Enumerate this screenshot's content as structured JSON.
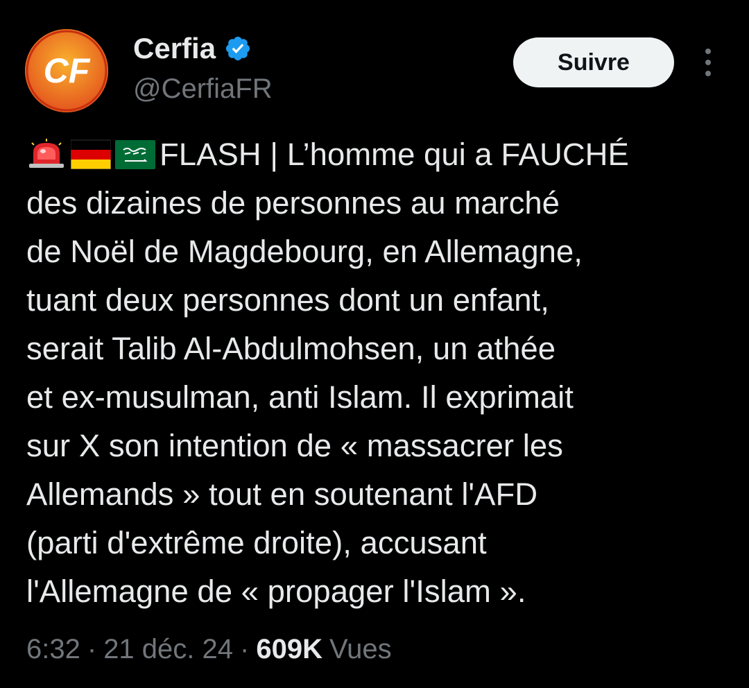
{
  "author": {
    "display_name": "Cerfia",
    "handle": "@CerfiaFR",
    "verified": true,
    "avatar_icon": "cerfia-logo",
    "avatar_color": "#f28a1e"
  },
  "actions": {
    "follow_label": "Suivre",
    "more_icon": "more-vertical-icon"
  },
  "tweet": {
    "emojis": [
      "rotating-light-emoji",
      "germany-flag-emoji",
      "saudi-arabia-flag-emoji"
    ],
    "lines": [
      "FLASH | L’homme qui a FAUCHÉ",
      "des dizaines de personnes au marché",
      "de Noël de Magdebourg, en Allemagne,",
      "tuant deux personnes dont un enfant,",
      "serait Talib Al-Abdulmohsen, un athée",
      "et ex-musulman, anti Islam. Il exprimait",
      "sur X son intention de « massacrer les",
      "Allemands » tout en soutenant l'AFD",
      "(parti d'extrême droite), accusant",
      "l'Allemagne de « propager l'Islam »."
    ]
  },
  "meta": {
    "time": "6:32",
    "separator": "·",
    "date": "21 déc. 24",
    "views_count": "609K",
    "views_label": "Vues"
  },
  "colors": {
    "background": "#000000",
    "text_primary": "#e7e9ea",
    "text_secondary": "#71767b",
    "verified_blue": "#1d9bf0",
    "follow_bg": "#eff3f4"
  }
}
